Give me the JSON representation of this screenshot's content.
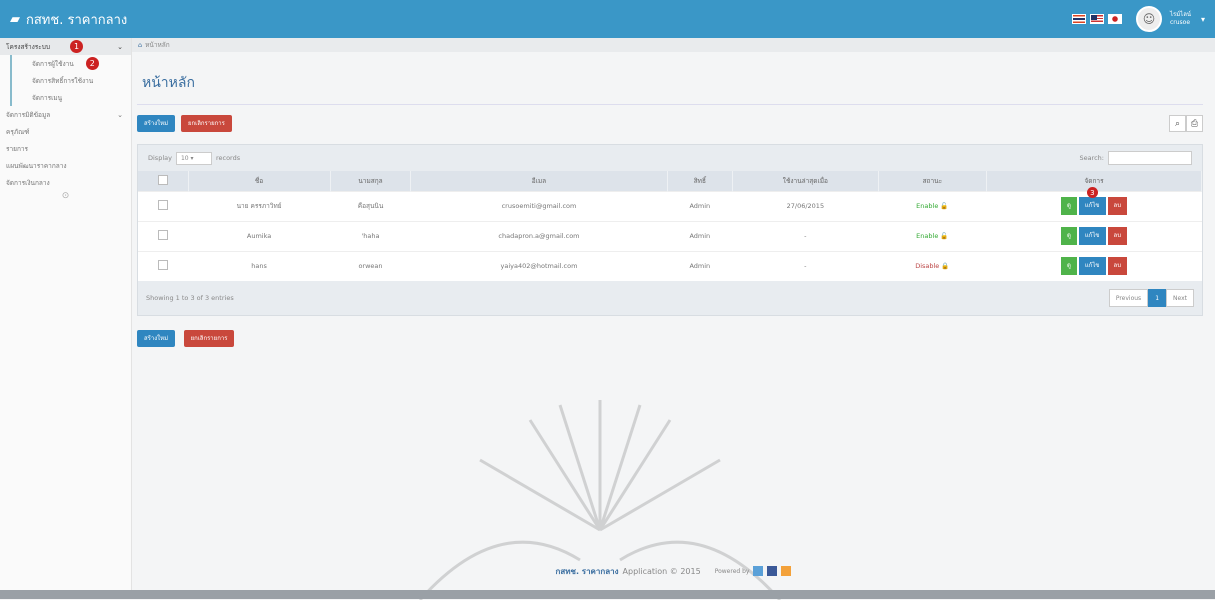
{
  "header": {
    "title": "กสทช. ราคากลาง",
    "user_line1": "ไรม์ไลน์",
    "user_line2": "crusoe"
  },
  "sidebar": {
    "items": [
      {
        "label": "โครงสร้างระบบ",
        "badge": "1"
      },
      {
        "label": "จัดการผู้ใช้งาน",
        "badge": "2"
      },
      {
        "label": "จัดการสิทธิ์การใช้งาน"
      },
      {
        "label": "จัดการเมนู"
      },
      {
        "label": "จัดการมิติข้อมูล"
      },
      {
        "label": "ครุภัณฑ์"
      },
      {
        "label": "รายการ"
      },
      {
        "label": "แผนพัฒนาราคากลาง"
      },
      {
        "label": "จัดการเงินกลาง"
      }
    ]
  },
  "breadcrumb": {
    "label": "หน้าหลัก"
  },
  "page": {
    "title": "หน้าหลัก",
    "create_label": "สร้างใหม่",
    "cancel_label": "ยกเลิกรายการ"
  },
  "table": {
    "display_label": "Display",
    "display_value": "10",
    "records_label": "records",
    "search_label": "Search:",
    "headers": [
      "ชื่อ",
      "นามสกุล",
      "อีเมล",
      "สิทธิ์",
      "ใช้งานล่าสุดเมื่อ",
      "สถานะ",
      "จัดการ"
    ],
    "rows": [
      {
        "name": "นาย ครรภาวิทย์",
        "surname": "คือสุนนิน",
        "email": "crusoemiti@gmail.com",
        "role": "Admin",
        "last": "27/06/2015",
        "status": "Enable"
      },
      {
        "name": "Aumika",
        "surname": "'haha",
        "email": "chadapron.a@gmail.com",
        "role": "Admin",
        "last": "-",
        "status": "Enable"
      },
      {
        "name": "hans",
        "surname": "orwean",
        "email": "yaiya402@hotmail.com",
        "role": "Admin",
        "last": "-",
        "status": "Disable"
      }
    ],
    "action_view": "ดู",
    "action_edit": "แก้ไข",
    "action_delete": "ลบ",
    "edit_badge": "3",
    "showing": "Showing 1 to 3 of 3 entries",
    "prev": "Previous",
    "page": "1",
    "next": "Next"
  },
  "footer": {
    "brand": "กสทช. ราคากลาง",
    "app": "Application © 2015",
    "powered": "Powered by"
  },
  "colors": {
    "topbar": "#3a97c7",
    "primary": "#2f86c0",
    "danger": "#c9483c",
    "success": "#4fb34a"
  }
}
